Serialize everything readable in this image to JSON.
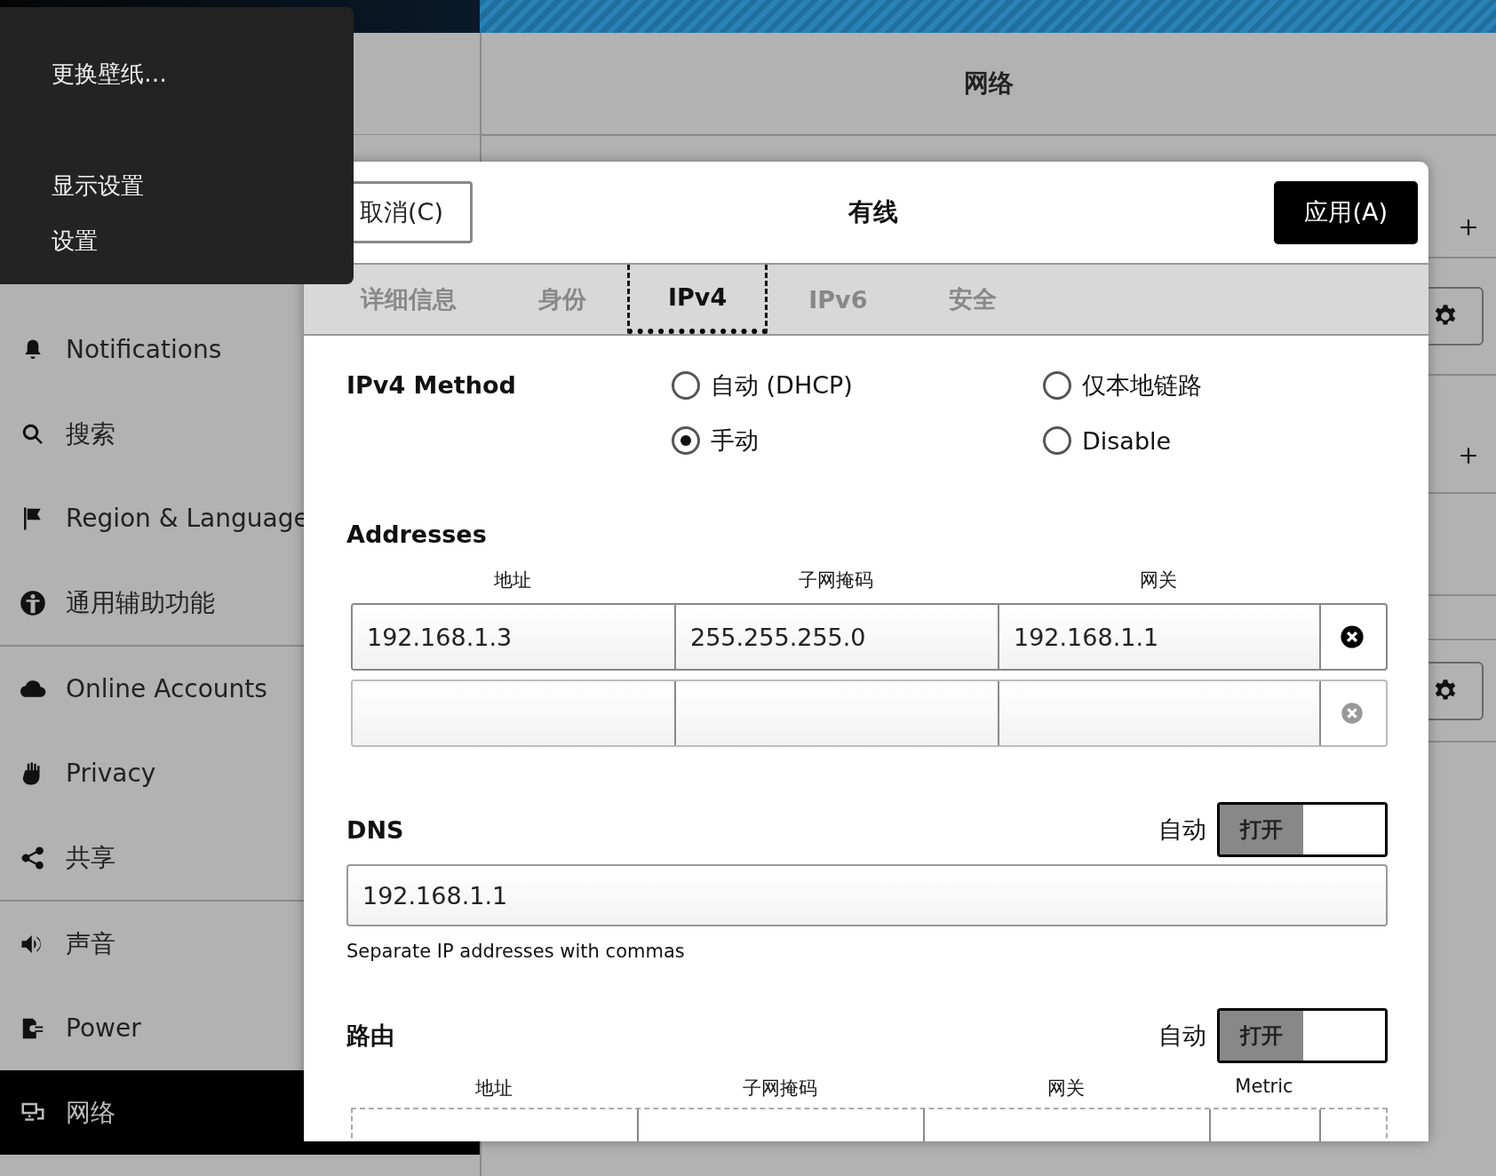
{
  "popup_menu": {
    "items": [
      "更换壁纸…",
      "显示设置",
      "设置"
    ]
  },
  "window": {
    "title": "网络"
  },
  "sidebar": {
    "groups": [
      [
        {
          "label": "Notifications",
          "selected": false
        },
        {
          "label": "搜索",
          "selected": false
        },
        {
          "label": "Region & Language",
          "selected": false
        },
        {
          "label": "通用辅助功能",
          "selected": false
        }
      ],
      [
        {
          "label": "Online Accounts",
          "selected": false
        },
        {
          "label": "Privacy",
          "selected": false
        },
        {
          "label": "共享",
          "selected": false
        }
      ],
      [
        {
          "label": "声音",
          "selected": false
        },
        {
          "label": "Power",
          "selected": false
        },
        {
          "label": "网络",
          "selected": true
        }
      ]
    ]
  },
  "dialog": {
    "title": "有线",
    "cancel": "取消(C)",
    "apply": "应用(A)",
    "tabs": [
      {
        "label": "详细信息",
        "selected": false
      },
      {
        "label": "身份",
        "selected": false
      },
      {
        "label": "IPv4",
        "selected": true
      },
      {
        "label": "IPv6",
        "selected": false
      },
      {
        "label": "安全",
        "selected": false
      }
    ],
    "ipv4_method": {
      "label": "IPv4 Method",
      "options": [
        {
          "label": "自动 (DHCP)",
          "selected": false
        },
        {
          "label": "仅本地链路",
          "selected": false
        },
        {
          "label": "手动",
          "selected": true
        },
        {
          "label": "Disable",
          "selected": false
        }
      ]
    },
    "addresses": {
      "title": "Addresses",
      "columns": [
        "地址",
        "子网掩码",
        "网关"
      ],
      "rows": [
        {
          "values": [
            "192.168.1.3",
            "255.255.255.0",
            "192.168.1.1"
          ],
          "disabled": false
        },
        {
          "disabled": true
        }
      ]
    },
    "dns": {
      "title": "DNS",
      "auto_label": "自动",
      "switch": {
        "label": "打开",
        "on": true
      },
      "value": "192.168.1.1",
      "hint": "Separate IP addresses with commas"
    },
    "routes": {
      "title": "路由",
      "auto_label": "自动",
      "switch": {
        "label": "打开",
        "on": true
      },
      "columns": [
        "地址",
        "子网掩码",
        "网关",
        "Metric"
      ]
    }
  }
}
